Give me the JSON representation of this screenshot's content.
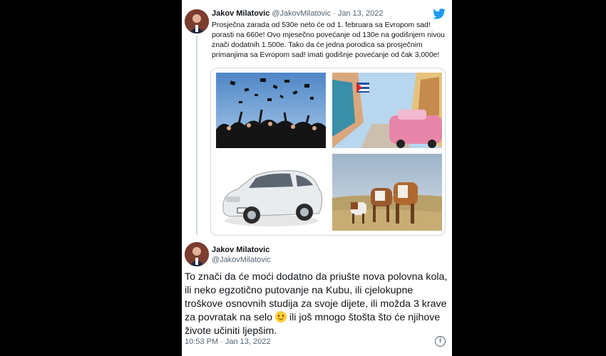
{
  "tweet1": {
    "name": "Jakov Milatovic",
    "meta": "@JakovMilatovic · Jan 13, 2022",
    "text": "Prosječna zarada od 530e neto će od 1. februara sa Evropom sad! porasti na 660e! Ovo mjesečno povećanje od 130e na godišnjem nivou znači dodatnih 1.500e. Tako da će jedna porodica sa prosječnim primanjima sa Evropom sad! imati godišnje povećanje od čak 3,000e!",
    "media": [
      {
        "name": "graduation-photo"
      },
      {
        "name": "havana-street-photo"
      },
      {
        "name": "white-car-photo"
      },
      {
        "name": "cows-photo"
      }
    ]
  },
  "tweet2": {
    "name": "Jakov Milatovic",
    "handle": "@JakovMilatovic",
    "text_before": "To znači da će moći dodatno da priušte nova polovna kola, ili neko egzotično putovanje na Kubu, ili cjelokupne troškove osnovnih studija za svoje dijete, ili možda 3 krave za povratak na selo ",
    "text_after": " ili još mnogo štošta što će njihove živote učiniti ljepšim.",
    "timestamp": "10:53 PM · Jan 13, 2022",
    "info_glyph": "i"
  },
  "colors": {
    "brand": "#1d9bf0",
    "text": "#0f1419",
    "muted": "#536471",
    "border": "#cfd9de"
  },
  "icons": [
    "twitter-bird-icon",
    "smile-emoji-icon",
    "info-icon"
  ]
}
